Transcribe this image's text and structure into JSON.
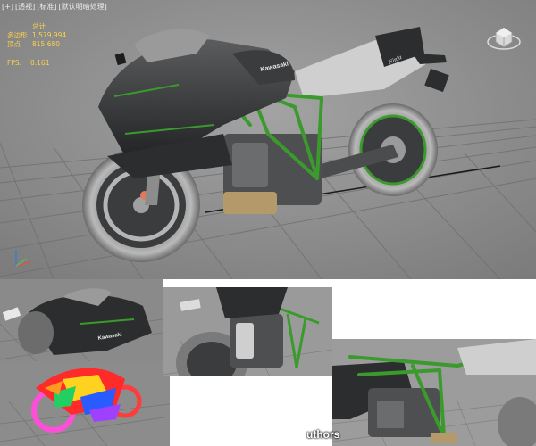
{
  "main_viewport": {
    "label_parts": [
      "[+]",
      "[透视]",
      "[标准]",
      "[默认明暗处理]"
    ],
    "stats": {
      "header": "总计",
      "rows": [
        {
          "key": "多边形",
          "value": "1,579,994"
        },
        {
          "key": "顶点",
          "value": "815,680"
        }
      ],
      "fps_key": "FPS:",
      "fps_value": "0.161"
    },
    "tank_brand": "Kawasaki",
    "tail_script": "Ninja"
  },
  "thumb_1": {
    "tank_brand": "Kawasaki"
  },
  "watermark": "uthors",
  "colors": {
    "viewport_bg": "#8e8e8e",
    "stats_text": "#ffd24a",
    "frame_green": "#3a9a2c",
    "body_dark": "#2b2d2e"
  }
}
